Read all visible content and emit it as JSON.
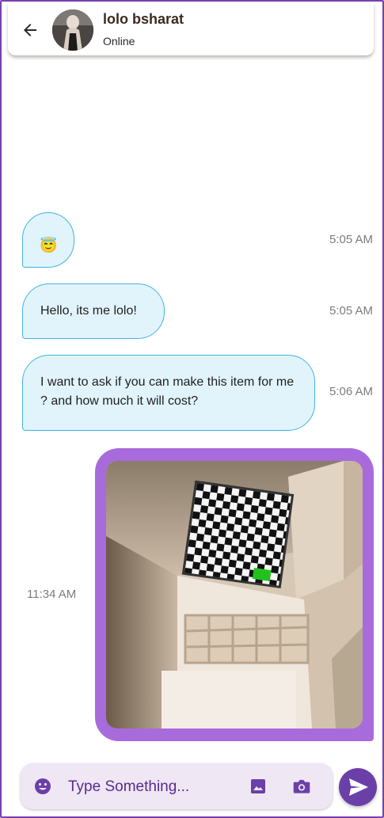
{
  "header": {
    "contact_name": "lolo bsharat",
    "status": "Online"
  },
  "messages": [
    {
      "kind": "emoji",
      "emoji": "😇",
      "time": "5:05 AM",
      "direction": "incoming"
    },
    {
      "kind": "text",
      "text": "Hello, its me lolo!",
      "time": "5:05 AM",
      "direction": "incoming"
    },
    {
      "kind": "text",
      "text": "I want to ask if you can make this item for me ? and how much it will cost?",
      "time": "5:06 AM",
      "direction": "incoming"
    },
    {
      "kind": "image",
      "time": "11:34 AM",
      "direction": "outgoing"
    }
  ],
  "composer": {
    "placeholder": "Type Something..."
  },
  "icons": {
    "back": "arrow-back-icon",
    "emoji": "smiley-icon",
    "gallery": "image-icon",
    "camera": "camera-icon",
    "send": "send-icon"
  },
  "colors": {
    "incoming_bubble": "#e1f4fc",
    "incoming_border": "#42b3e0",
    "outgoing_frame": "#a86bdc",
    "accent": "#6b3fa8",
    "composer_bg": "#efe7f3"
  }
}
